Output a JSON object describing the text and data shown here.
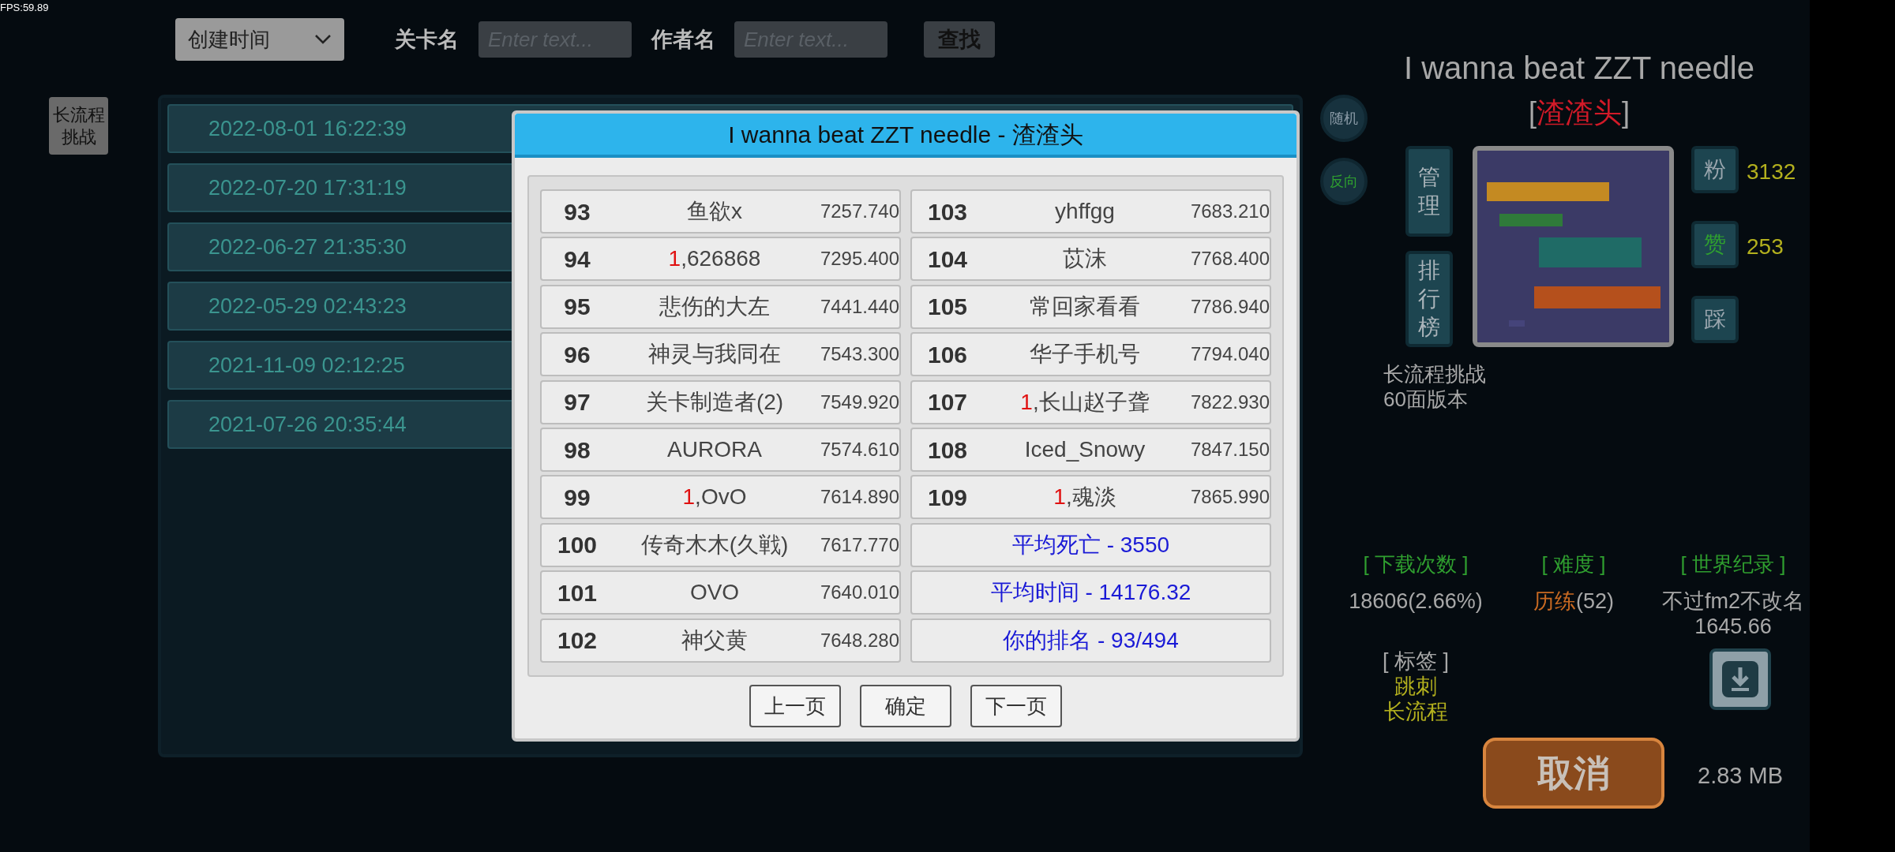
{
  "fps": "FPS:59.89",
  "toolbar": {
    "sort": "创建时间",
    "level_label": "关卡名",
    "level_placeholder": "Enter text...",
    "author_label": "作者名",
    "author_placeholder": "Enter text...",
    "search": "查找"
  },
  "side_button": "长流程挑战",
  "list": [
    {
      "time": "2022-08-01 16:22:39"
    },
    {
      "time": "2022-07-20 17:31:19"
    },
    {
      "time": "2022-06-27 21:35:30"
    },
    {
      "time": "2022-05-29 02:43:23"
    },
    {
      "time": "2021-11-09 02:12:25"
    },
    {
      "time": "2021-07-26 20:35:44"
    }
  ],
  "dialog": {
    "title": "I wanna beat ZZT needle - 渣渣头",
    "cells": [
      {
        "kind": "entry",
        "rank": "93",
        "name": "鱼欲x",
        "time": "7257.740"
      },
      {
        "kind": "entry",
        "rank": "94",
        "tag": "1",
        "name": ",626868",
        "time": "7295.400"
      },
      {
        "kind": "entry",
        "rank": "95",
        "name": "悲伤的大左",
        "time": "7441.440"
      },
      {
        "kind": "entry",
        "rank": "96",
        "name": "神灵与我同在",
        "time": "7543.300"
      },
      {
        "kind": "entry",
        "rank": "97",
        "name": "关卡制造者(2)",
        "time": "7549.920"
      },
      {
        "kind": "entry",
        "rank": "98",
        "name": "AURORA",
        "time": "7574.610"
      },
      {
        "kind": "entry",
        "rank": "99",
        "tag": "1",
        "name": ",OvO",
        "time": "7614.890"
      },
      {
        "kind": "entry",
        "rank": "100",
        "name": "传奇木木(久戦)",
        "time": "7617.770"
      },
      {
        "kind": "entry",
        "rank": "101",
        "name": "OVO",
        "time": "7640.010"
      },
      {
        "kind": "entry",
        "rank": "102",
        "name": "神父黄",
        "time": "7648.280"
      },
      {
        "kind": "entry",
        "rank": "103",
        "name": "yhffgg",
        "time": "7683.210"
      },
      {
        "kind": "entry",
        "rank": "104",
        "name": "苡沫",
        "time": "7768.400"
      },
      {
        "kind": "entry",
        "rank": "105",
        "name": "常回家看看",
        "time": "7786.940"
      },
      {
        "kind": "entry",
        "rank": "106",
        "name": "华子手机号",
        "time": "7794.040"
      },
      {
        "kind": "entry",
        "rank": "107",
        "tag": "1",
        "name": ",长山赵子聋",
        "time": "7822.930"
      },
      {
        "kind": "entry",
        "rank": "108",
        "name": "Iced_Snowy",
        "time": "7847.150"
      },
      {
        "kind": "entry",
        "rank": "109",
        "tag": "1",
        "name": ",魂淡",
        "time": "7865.990"
      },
      {
        "kind": "summary",
        "text": "平均死亡 - 3550"
      },
      {
        "kind": "summary",
        "text": "平均时间 - 14176.32"
      },
      {
        "kind": "summary",
        "text": "你的排名 - 93/494"
      }
    ],
    "buttons": [
      "上一页",
      "确定",
      "下一页"
    ]
  },
  "side_round_buttons": [
    {
      "label": "随机",
      "active": false
    },
    {
      "label": "反向",
      "active": true
    }
  ],
  "detail": {
    "title": "I wanna beat ZZT needle",
    "author_open": "[",
    "author": "渣渣头",
    "author_close": "]",
    "left_buttons": [
      "管理",
      "排行榜"
    ],
    "counters": [
      {
        "label": "粉",
        "active": false,
        "value": "3132"
      },
      {
        "label": "赞",
        "active": true,
        "value": "253"
      },
      {
        "label": "踩",
        "active": false
      }
    ],
    "description": [
      "长流程挑战",
      "60面版本"
    ],
    "downloads_label": "[ 下载次数 ]",
    "downloads": "18606(2.66%)",
    "difficulty_label": "[ 难度 ]",
    "difficulty_name": "历练",
    "difficulty_score": "(52)",
    "record_label": "[ 世界纪录 ]",
    "record_holder": "不过fm2不改名",
    "record_time": "1645.66",
    "tags_label": "[ 标签 ]",
    "tags": [
      "跳刺",
      "长流程"
    ],
    "cancel": "取消",
    "size": "2.83 MB"
  }
}
